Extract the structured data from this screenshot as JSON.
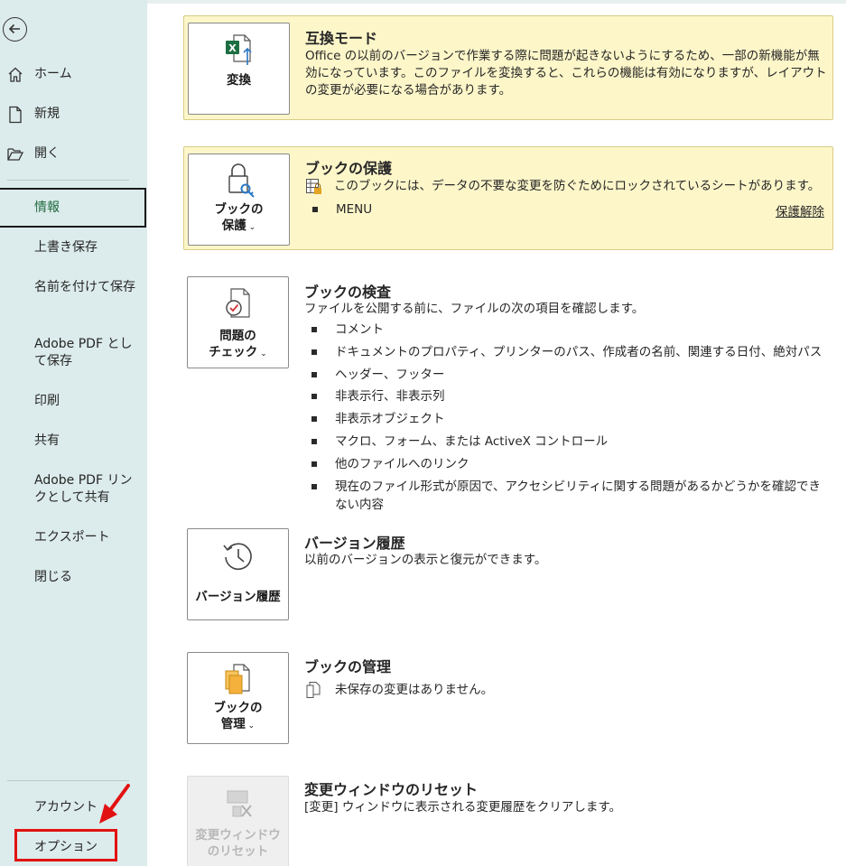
{
  "sidebar": {
    "back_icon": "back-arrow-icon",
    "home": "ホーム",
    "new": "新規",
    "open": "開く",
    "info": "情報",
    "save": "上書き保存",
    "save_as": "名前を付けて保存",
    "save_as_pdf": "Adobe PDF として保存",
    "print": "印刷",
    "share": "共有",
    "share_pdf_link": "Adobe PDF リンクとして共有",
    "export": "エクスポート",
    "close": "閉じる",
    "account": "アカウント",
    "options": "オプション"
  },
  "compat": {
    "tile_label": "変換",
    "title": "互換モード",
    "description": "Office の以前のバージョンで作業する際に問題が起きないようにするため、一部の新機能が無効になっています。このファイルを変換すると、これらの機能は有効になりますが、レイアウトの変更が必要になる場合があります。"
  },
  "protect": {
    "tile_line1": "ブックの",
    "tile_line2": "保護",
    "title": "ブックの保護",
    "message": "このブックには、データの不要な変更を防ぐためにロックされているシートがあります。",
    "sheet": "MENU",
    "unprotect_link": "保護解除"
  },
  "inspect": {
    "tile_line1": "問題の",
    "tile_line2": "チェック",
    "title": "ブックの検査",
    "description": "ファイルを公開する前に、ファイルの次の項目を確認します。",
    "items": [
      "コメント",
      "ドキュメントのプロパティ、プリンターのパス、作成者の名前、関連する日付、絶対パス",
      "ヘッダー、フッター",
      "非表示行、非表示列",
      "非表示オブジェクト",
      "マクロ、フォーム、または ActiveX コントロール",
      "他のファイルへのリンク",
      "現在のファイル形式が原因で、アクセシビリティに関する問題があるかどうかを確認できない内容"
    ]
  },
  "version": {
    "tile_label": "バージョン履歴",
    "title": "バージョン履歴",
    "description": "以前のバージョンの表示と復元ができます。"
  },
  "manage": {
    "tile_line1": "ブックの",
    "tile_line2": "管理",
    "title": "ブックの管理",
    "message": "未保存の変更はありません。"
  },
  "reset": {
    "tile_line1": "変更ウィンドウ",
    "tile_line2": "のリセット",
    "title": "変更ウィンドウのリセット",
    "description": "[変更] ウィンドウに表示される変更履歴をクリアします。"
  },
  "colors": {
    "sidebar_bg": "#dcebeb",
    "warning_bg": "#fdf6c9",
    "info_green": "#1e6b3e",
    "highlight_red": "#e21111"
  }
}
